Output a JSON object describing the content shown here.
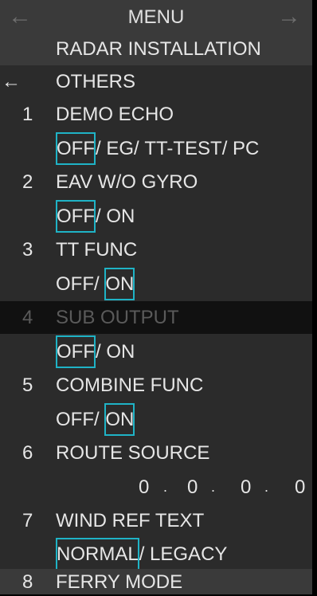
{
  "header": {
    "title": "MENU",
    "left_arrow": "←",
    "right_arrow": "→"
  },
  "submenu": {
    "title": "RADAR INSTALLATION",
    "back_arrow": "←",
    "back_label": "OTHERS"
  },
  "items": [
    {
      "num": "1",
      "label": "DEMO ECHO",
      "options": [
        "OFF",
        "EG",
        "TT-TEST",
        "PC"
      ],
      "selected": "OFF"
    },
    {
      "num": "2",
      "label": "EAV W/O GYRO",
      "options": [
        "OFF",
        "ON"
      ],
      "selected": "OFF"
    },
    {
      "num": "3",
      "label": "TT FUNC",
      "options": [
        "OFF",
        "ON"
      ],
      "selected": "ON"
    },
    {
      "num": "4",
      "label": "SUB OUTPUT",
      "options": [
        "OFF",
        "ON"
      ],
      "selected": "OFF"
    },
    {
      "num": "5",
      "label": "COMBINE FUNC",
      "options": [
        "OFF",
        "ON"
      ],
      "selected": "ON"
    },
    {
      "num": "6",
      "label": "ROUTE SOURCE",
      "value": [
        "0",
        "0",
        "0",
        "0"
      ]
    },
    {
      "num": "7",
      "label": "WIND REF TEXT",
      "options": [
        "NORMAL",
        "LEGACY"
      ],
      "selected": "NORMAL"
    },
    {
      "num": "8",
      "label": "FERRY MODE"
    }
  ],
  "separator": "/",
  "ip_separator": "."
}
